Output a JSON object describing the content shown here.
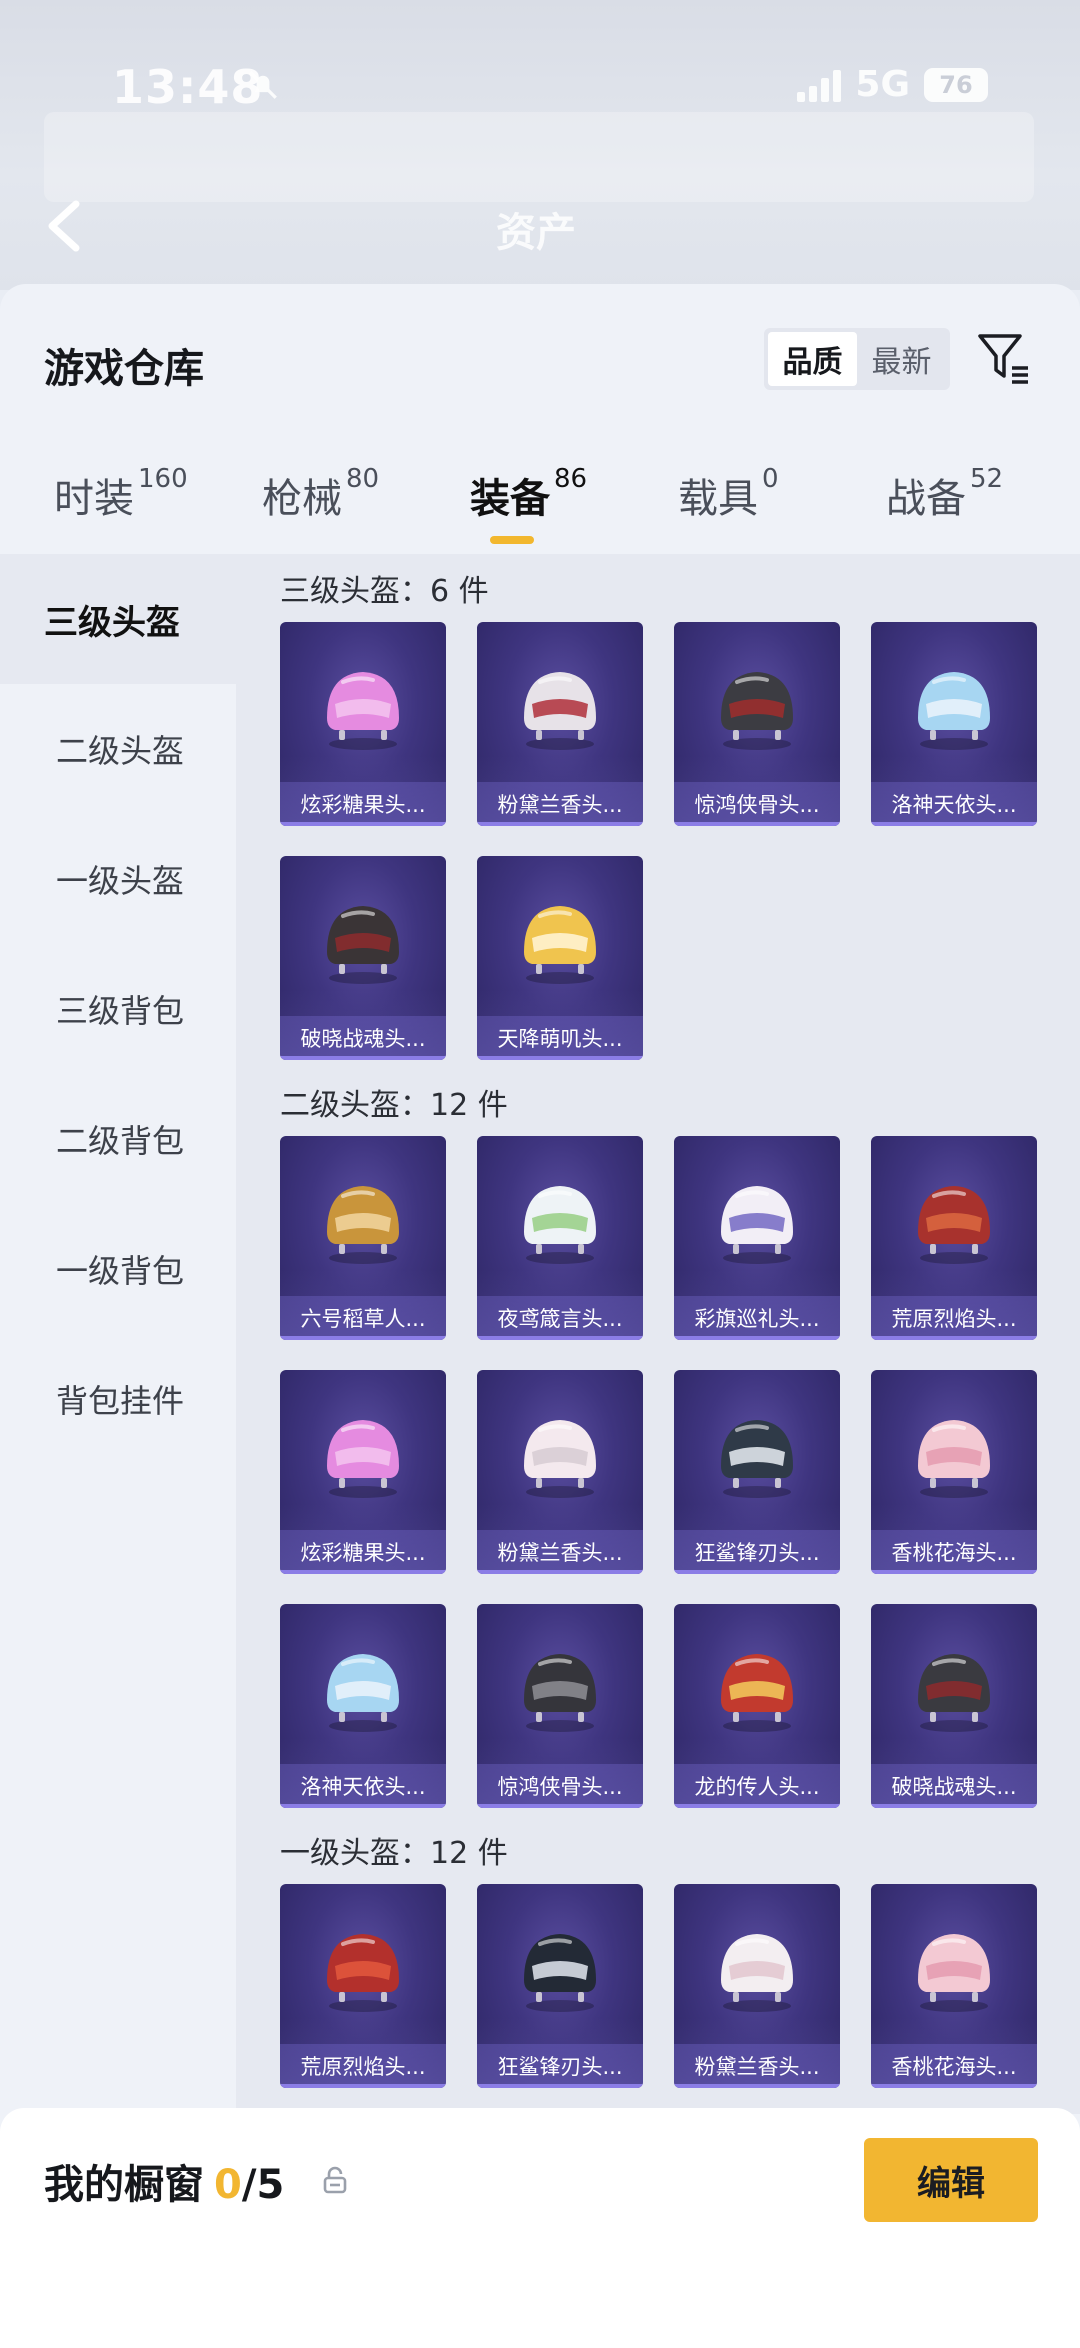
{
  "status": {
    "time": "13:48",
    "network": "5G",
    "battery": "76"
  },
  "header": {
    "title": "资产"
  },
  "sheet": {
    "title": "游戏仓库",
    "sort": [
      {
        "label": "品质",
        "active": true
      },
      {
        "label": "最新",
        "active": false
      }
    ]
  },
  "tabs": [
    {
      "label": "时装",
      "count": "160"
    },
    {
      "label": "枪械",
      "count": "80"
    },
    {
      "label": "装备",
      "count": "86"
    },
    {
      "label": "载具",
      "count": "0"
    },
    {
      "label": "战备",
      "count": "52"
    }
  ],
  "sidebar": [
    {
      "label": "三级头盔"
    },
    {
      "label": "二级头盔"
    },
    {
      "label": "一级头盔"
    },
    {
      "label": "三级背包"
    },
    {
      "label": "二级背包"
    },
    {
      "label": "一级背包"
    },
    {
      "label": "背包挂件"
    }
  ],
  "sections": [
    {
      "title": "三级头盔：6 件",
      "items": [
        "炫彩糖果头...",
        "粉黛兰香头...",
        "惊鸿侠骨头...",
        "洛神天依头...",
        "破晓战魂头...",
        "天降萌叽头..."
      ]
    },
    {
      "title": "二级头盔：12 件",
      "items": [
        "六号稻草人...",
        "夜鸢箴言头...",
        "彩旗巡礼头...",
        "荒原烈焰头...",
        "炫彩糖果头...",
        "粉黛兰香头...",
        "狂鲨锋刃头...",
        "香桃花海头...",
        "洛神天依头...",
        "惊鸿侠骨头...",
        "龙的传人头...",
        "破晓战魂头..."
      ]
    },
    {
      "title": "一级头盔：12 件",
      "items": [
        "荒原烈焰头...",
        "狂鲨锋刃头...",
        "粉黛兰香头...",
        "香桃花海头..."
      ]
    }
  ],
  "bottom": {
    "label": "我的橱窗",
    "current": "0",
    "max": "/5",
    "edit": "编辑"
  },
  "colors": {
    "accent": "#f2b631",
    "card": "#3f3580"
  }
}
